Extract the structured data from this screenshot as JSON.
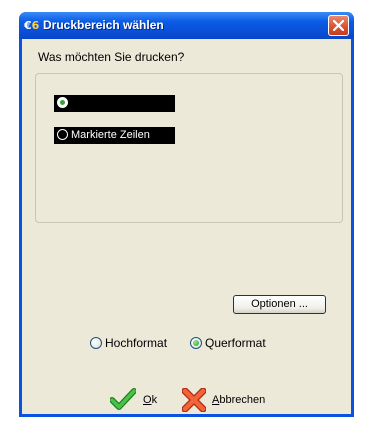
{
  "window": {
    "title": "Druckbereich wählen"
  },
  "prompt": "Was möchten Sie drucken?",
  "print_area_options": [
    {
      "label": "",
      "selected": true
    },
    {
      "label": "Markierte Zeilen",
      "selected": false
    }
  ],
  "options_button": "Optionen ...",
  "orientation": {
    "portrait_label": "Hochformat",
    "landscape_label": "Querformat",
    "selected": "Querformat"
  },
  "buttons": {
    "ok_accel": "O",
    "ok_rest": "k",
    "cancel_accel": "A",
    "cancel_rest": "bbrechen"
  },
  "colors": {
    "titlebar": "#0b5ce6",
    "dialog_bg": "#ece9d8",
    "ok_icon": "#2ea02e",
    "cancel_icon": "#e8512a"
  }
}
